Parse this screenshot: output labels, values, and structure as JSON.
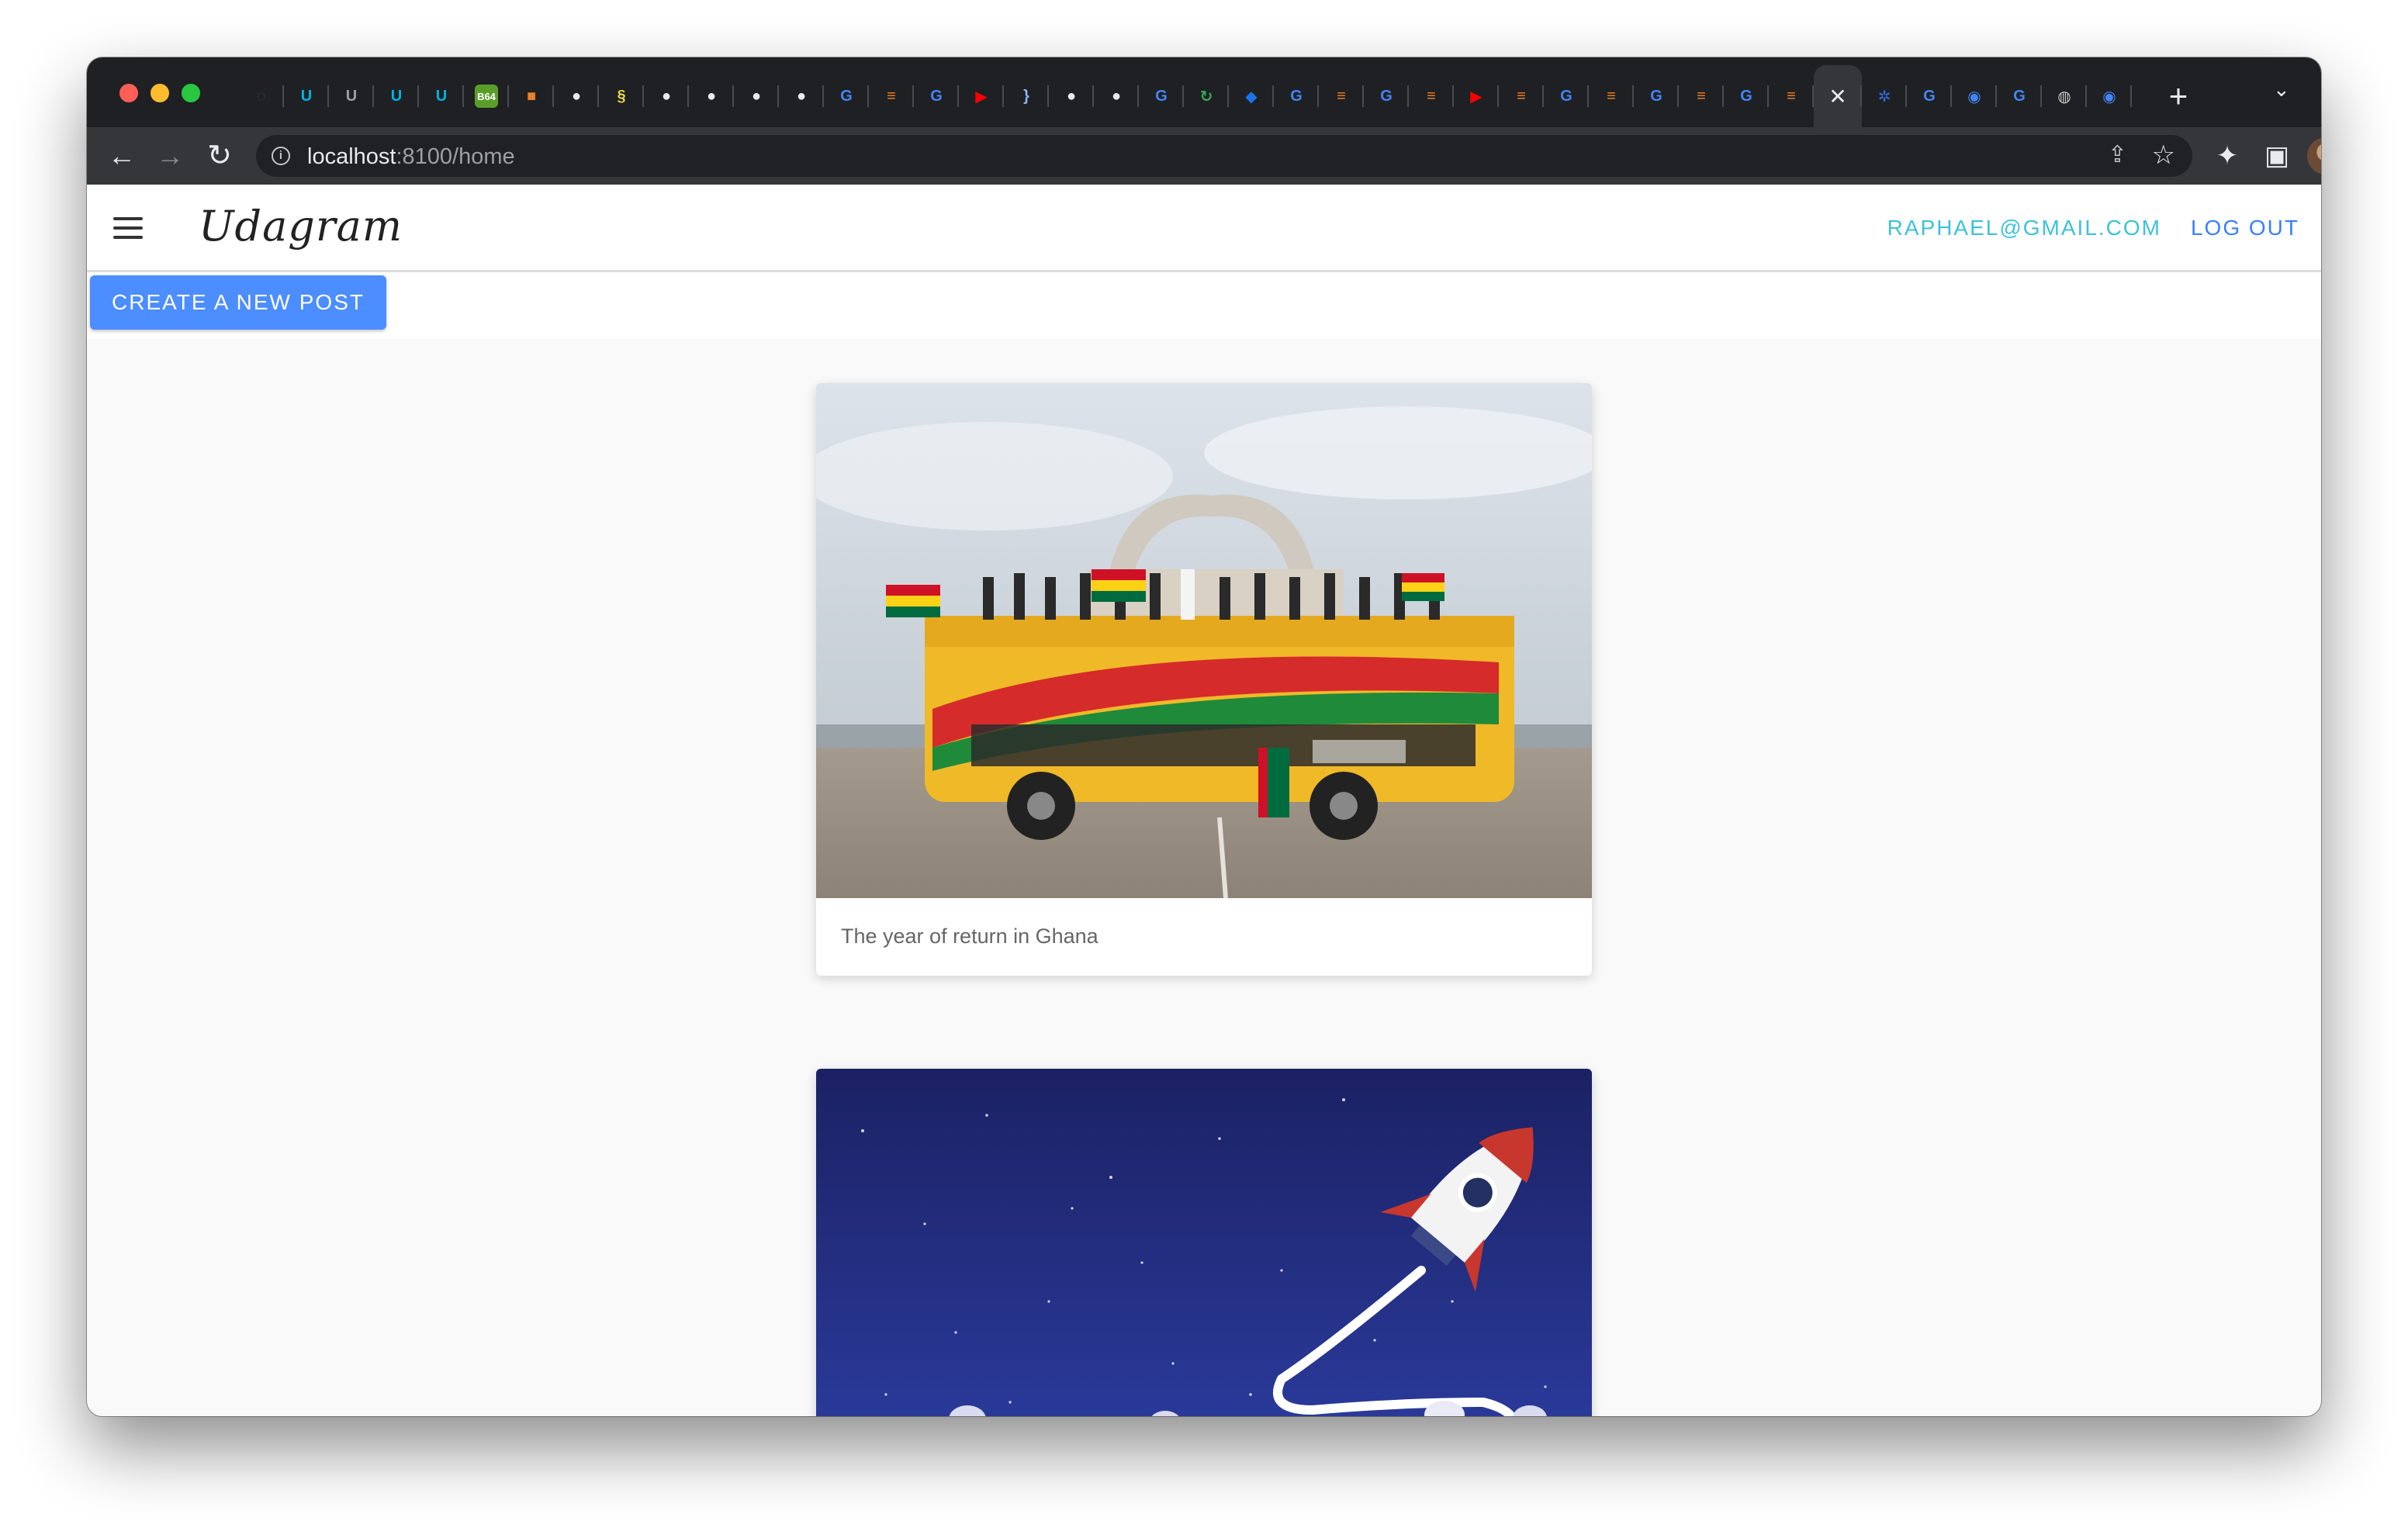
{
  "browser": {
    "tabs": [
      {
        "icon": "globe-icon",
        "glyph": "◌",
        "color": "#2a4b6e"
      },
      {
        "icon": "udacity-icon",
        "glyph": "U",
        "color": "#02b3e4"
      },
      {
        "icon": "udacity-icon",
        "glyph": "U",
        "color": "#9aa0a6"
      },
      {
        "icon": "udacity-icon",
        "glyph": "U",
        "color": "#02b3e4"
      },
      {
        "icon": "udacity-icon",
        "glyph": "U",
        "color": "#02b3e4"
      },
      {
        "icon": "b64-icon",
        "glyph": "B64",
        "color": "#5a9e2a"
      },
      {
        "icon": "box-icon",
        "glyph": "■",
        "color": "#e8822a"
      },
      {
        "icon": "github-icon",
        "glyph": "●",
        "color": "#e8eaed"
      },
      {
        "icon": "snake-icon",
        "glyph": "§",
        "color": "#e8d44d"
      },
      {
        "icon": "github-icon",
        "glyph": "●",
        "color": "#e8eaed"
      },
      {
        "icon": "github-icon",
        "glyph": "●",
        "color": "#e8eaed"
      },
      {
        "icon": "github-icon",
        "glyph": "●",
        "color": "#e8eaed"
      },
      {
        "icon": "github-icon",
        "glyph": "●",
        "color": "#e8eaed"
      },
      {
        "icon": "google-icon",
        "glyph": "G",
        "color": "#4285f4"
      },
      {
        "icon": "stackoverflow-icon",
        "glyph": "≡",
        "color": "#f48024"
      },
      {
        "icon": "google-icon",
        "glyph": "G",
        "color": "#4285f4"
      },
      {
        "icon": "youtube-icon",
        "glyph": "▶",
        "color": "#ff0000"
      },
      {
        "icon": "brace-icon",
        "glyph": "}",
        "color": "#8ab4f8"
      },
      {
        "icon": "github-icon",
        "glyph": "●",
        "color": "#e8eaed"
      },
      {
        "icon": "github-icon",
        "glyph": "●",
        "color": "#e8eaed"
      },
      {
        "icon": "google-icon",
        "glyph": "G",
        "color": "#4285f4"
      },
      {
        "icon": "refresh-icon",
        "glyph": "↻",
        "color": "#34a853"
      },
      {
        "icon": "diamond-icon",
        "glyph": "◆",
        "color": "#1a73e8"
      },
      {
        "icon": "google-icon",
        "glyph": "G",
        "color": "#4285f4"
      },
      {
        "icon": "stackoverflow-icon",
        "glyph": "≡",
        "color": "#f48024"
      },
      {
        "icon": "google-icon",
        "glyph": "G",
        "color": "#4285f4"
      },
      {
        "icon": "stackoverflow-icon",
        "glyph": "≡",
        "color": "#f48024"
      },
      {
        "icon": "youtube-icon",
        "glyph": "▶",
        "color": "#ff0000"
      },
      {
        "icon": "stackoverflow-icon",
        "glyph": "≡",
        "color": "#f48024"
      },
      {
        "icon": "google-icon",
        "glyph": "G",
        "color": "#4285f4"
      },
      {
        "icon": "stackoverflow-icon",
        "glyph": "≡",
        "color": "#f48024"
      },
      {
        "icon": "google-icon",
        "glyph": "G",
        "color": "#4285f4"
      },
      {
        "icon": "stackoverflow-icon",
        "glyph": "≡",
        "color": "#f48024"
      },
      {
        "icon": "google-icon",
        "glyph": "G",
        "color": "#4285f4"
      },
      {
        "icon": "stackoverflow-icon",
        "glyph": "≡",
        "color": "#f48024"
      },
      {
        "icon": "close-icon",
        "glyph": "✕",
        "color": "#e8eaed",
        "active": true
      },
      {
        "icon": "kubernetes-icon",
        "glyph": "✲",
        "color": "#326ce5"
      },
      {
        "icon": "google-icon",
        "glyph": "G",
        "color": "#4285f4"
      },
      {
        "icon": "circle-icon",
        "glyph": "◉",
        "color": "#4285f4"
      },
      {
        "icon": "google-icon",
        "glyph": "G",
        "color": "#4285f4"
      },
      {
        "icon": "globe-icon",
        "glyph": "◍",
        "color": "#c6c6c6"
      },
      {
        "icon": "circle-icon",
        "glyph": "◉",
        "color": "#4285f4"
      }
    ],
    "url_host": "localhost",
    "url_path": ":8100/home"
  },
  "header": {
    "brand": "Udagram",
    "user_email": "RAPHAEL@GMAIL.COM",
    "logout_label": "LOG OUT"
  },
  "actions": {
    "create_post_label": "CREATE A NEW POST"
  },
  "feed": {
    "posts": [
      {
        "caption": "The year of return in Ghana"
      },
      {
        "caption": ""
      }
    ]
  },
  "colors": {
    "primary": "#3880ff",
    "secondary": "#3dc2d8",
    "button": "#4c8dff"
  }
}
